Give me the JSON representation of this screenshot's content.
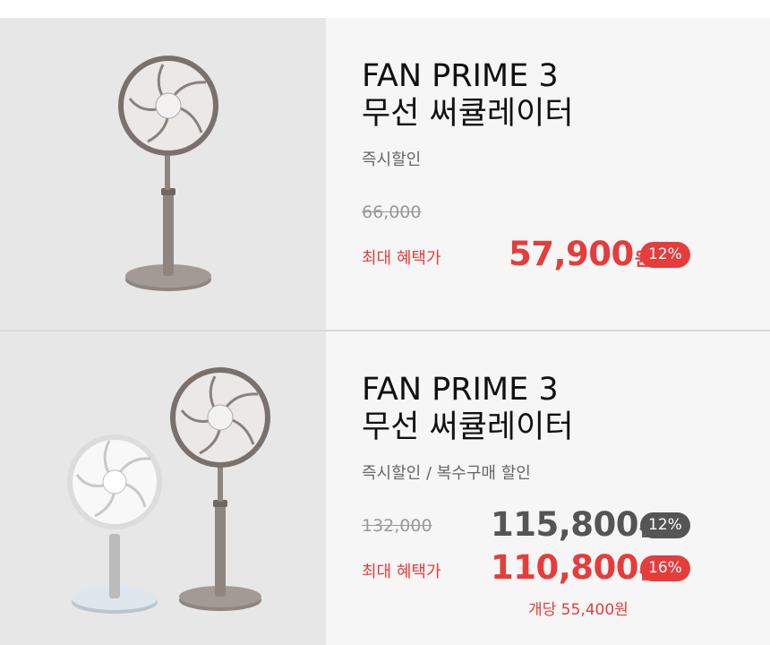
{
  "products": [
    {
      "title_line1": "FAN PRIME 3",
      "title_line2": "무선 써큘레이터",
      "subtitle": "즉시할인",
      "original_price": "66,000",
      "benefit_label": "최대 혜택가",
      "final_price": "57,900",
      "currency": "원",
      "discount": "12%",
      "image_alt": "fan-prime-3-grey-image"
    },
    {
      "title_line1": "FAN PRIME 3",
      "title_line2": "무선 써큘레이터",
      "subtitle": "즉시할인 / 복수구매 할인",
      "original_price": "132,000",
      "instant_price": "115,800",
      "instant_discount": "12%",
      "benefit_label": "최대 혜택가",
      "final_price": "110,800",
      "currency": "원",
      "discount": "16%",
      "per_unit": "개당 55,400원",
      "image_alt": "fan-prime-3-pair-image"
    }
  ],
  "colors": {
    "accent_red": "#e63c3c",
    "badge_dark": "#555555",
    "image_bg": "#e7e7e7",
    "info_bg": "#f6f6f6"
  }
}
